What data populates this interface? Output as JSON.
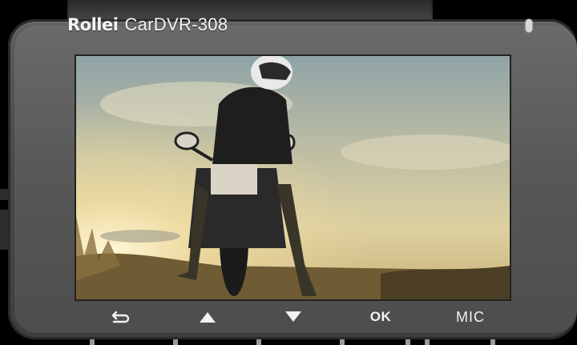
{
  "brand": {
    "logo": "Rollei",
    "model": "CarDVR-308"
  },
  "buttons": {
    "back_icon": "return-arrow-icon",
    "up_icon": "triangle-up-icon",
    "down_icon": "triangle-down-icon",
    "ok_label": "OK",
    "mic_label": "MIC"
  },
  "colors": {
    "body": "#555555",
    "screen_sky": "#cfc7a0",
    "text": "#f2f2f2"
  }
}
